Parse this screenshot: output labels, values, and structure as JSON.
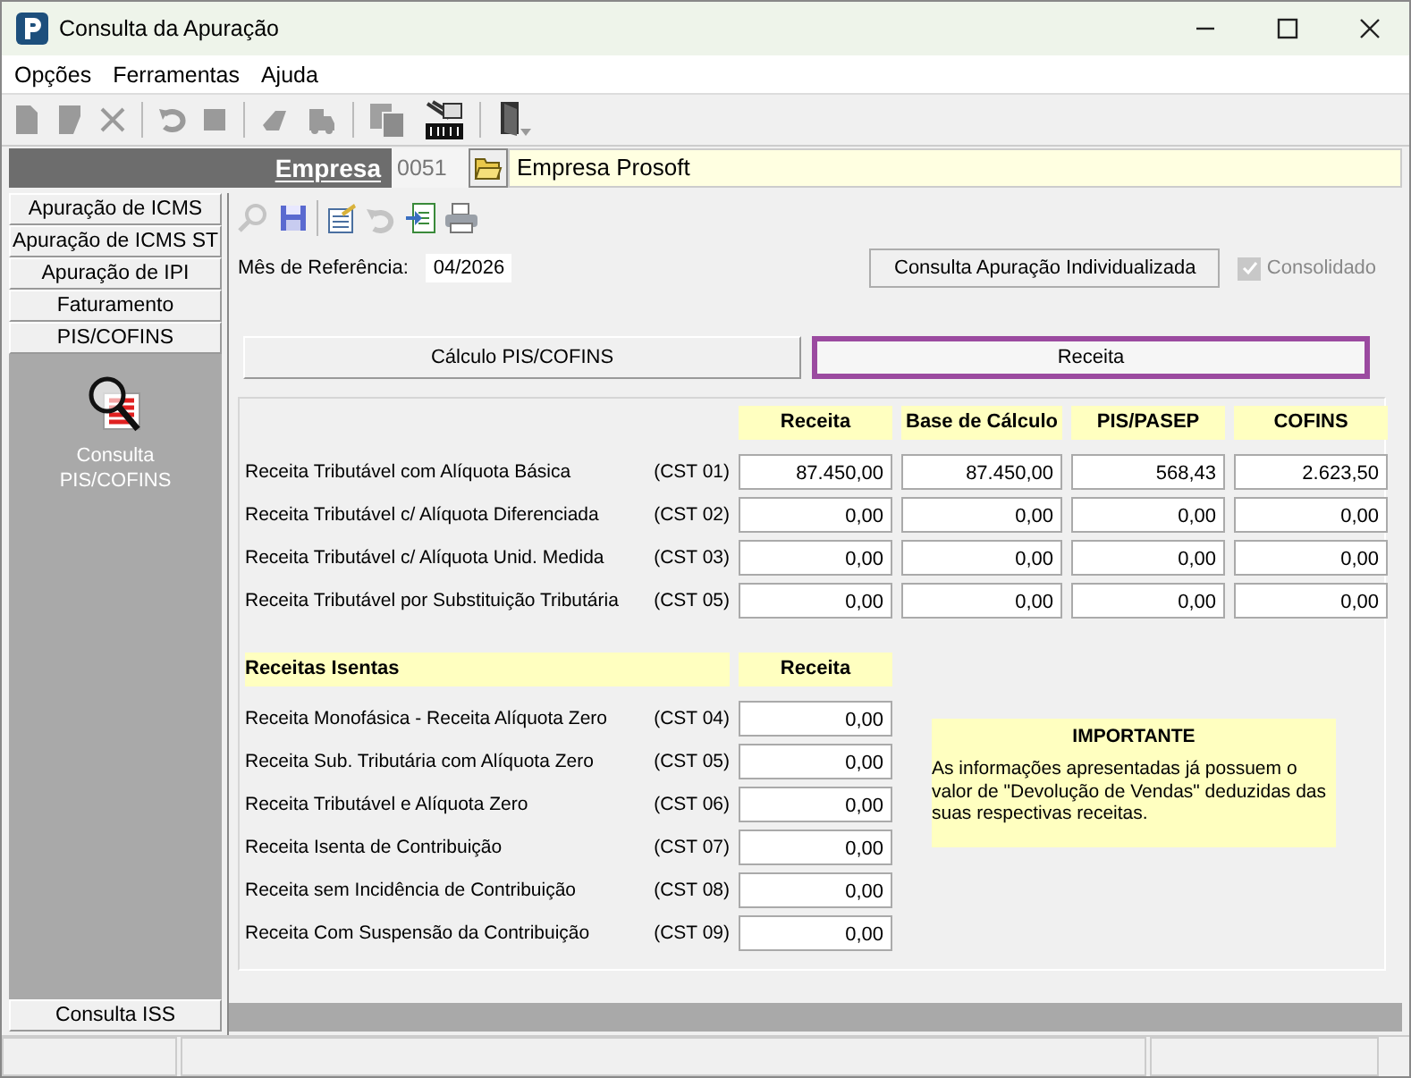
{
  "window": {
    "title": "Consulta da Apuração"
  },
  "menu": [
    "Opções",
    "Ferramentas",
    "Ajuda"
  ],
  "empresa": {
    "label": "Empresa",
    "code": "0051",
    "name": "Empresa Prosoft"
  },
  "sidebar": {
    "items": [
      "Apuração de ICMS",
      "Apuração de ICMS ST",
      "Apuração de IPI",
      "Faturamento",
      "PIS/COFINS"
    ],
    "module_label": "Consulta PIS/COFINS",
    "bottom_item": "Consulta ISS"
  },
  "reference": {
    "label": "Mês de Referência:",
    "value": "04/2026"
  },
  "individual_button": "Consulta Apuração Individualizada",
  "consolidado": {
    "label": "Consolidado",
    "checked": true,
    "disabled": true
  },
  "tabs": [
    {
      "label": "Cálculo PIS/COFINS",
      "selected": false
    },
    {
      "label": "Receita",
      "selected": true
    }
  ],
  "taxed": {
    "columns": [
      "Receita",
      "Base de Cálculo",
      "PIS/PASEP",
      "COFINS"
    ],
    "rows": [
      {
        "label": "Receita Tributável com Alíquota Básica",
        "cst": "(CST 01)",
        "values": [
          "87.450,00",
          "87.450,00",
          "568,43",
          "2.623,50"
        ]
      },
      {
        "label": "Receita Tributável c/ Alíquota Diferenciada",
        "cst": "(CST 02)",
        "values": [
          "0,00",
          "0,00",
          "0,00",
          "0,00"
        ]
      },
      {
        "label": "Receita Tributável c/ Alíquota Unid. Medida",
        "cst": "(CST 03)",
        "values": [
          "0,00",
          "0,00",
          "0,00",
          "0,00"
        ]
      },
      {
        "label": "Receita Tributável por Substituição Tributária",
        "cst": "(CST 05)",
        "values": [
          "0,00",
          "0,00",
          "0,00",
          "0,00"
        ]
      }
    ]
  },
  "exempt": {
    "title": "Receitas Isentas",
    "column": "Receita",
    "rows": [
      {
        "label": "Receita Monofásica - Receita Alíquota Zero",
        "cst": "(CST 04)",
        "value": "0,00"
      },
      {
        "label": "Receita Sub. Tributária com Alíquota Zero",
        "cst": "(CST 05)",
        "value": "0,00"
      },
      {
        "label": "Receita Tributável e Alíquota Zero",
        "cst": "(CST 06)",
        "value": "0,00"
      },
      {
        "label": "Receita Isenta de Contribuição",
        "cst": "(CST 07)",
        "value": "0,00"
      },
      {
        "label": "Receita sem Incidência de Contribuição",
        "cst": "(CST 08)",
        "value": "0,00"
      },
      {
        "label": "Receita Com Suspensão da Contribuição",
        "cst": "(CST 09)",
        "value": "0,00"
      }
    ]
  },
  "notice": {
    "title": "IMPORTANTE",
    "text": "As informações apresentadas já possuem o valor de \"Devolução de Vendas\" deduzidas das suas respectivas receitas."
  }
}
